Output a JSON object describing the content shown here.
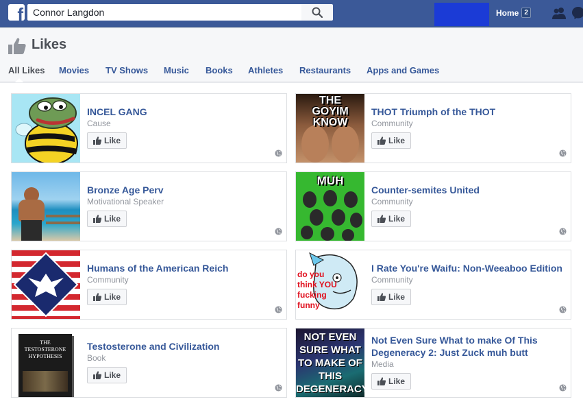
{
  "search": {
    "value": "Connor Langdon"
  },
  "header": {
    "title": "Likes",
    "home_label": "Home",
    "home_badge": "2"
  },
  "tabs": [
    {
      "label": "All Likes",
      "active": true
    },
    {
      "label": "Movies"
    },
    {
      "label": "TV Shows"
    },
    {
      "label": "Music"
    },
    {
      "label": "Books"
    },
    {
      "label": "Athletes"
    },
    {
      "label": "Restaurants"
    },
    {
      "label": "Apps and Games"
    }
  ],
  "like_label": "Like",
  "pages": [
    {
      "name": "INCEL GANG",
      "category": "Cause",
      "thumb_text": ""
    },
    {
      "name": "THOT Triumph of the THOT",
      "category": "Community",
      "thumb_text": "THE GOYIM KNOW"
    },
    {
      "name": "Bronze Age Perv",
      "category": "Motivational Speaker",
      "thumb_text": ""
    },
    {
      "name": "Counter-semites United",
      "category": "Community",
      "thumb_text": "MUH"
    },
    {
      "name": "Humans of the American Reich",
      "category": "Community",
      "thumb_text": ""
    },
    {
      "name": "I Rate You're Waifu: Non-Weeaboo Edition",
      "category": "Community",
      "thumb_text": "do you think YOU fucking funny"
    },
    {
      "name": "Testosterone and Civilization",
      "category": "Book",
      "thumb_text": "THE TESTOSTERONE HYPOTHESIS"
    },
    {
      "name": "Not Even Sure What to make Of This Degeneracy 2: Just Zuck muh butt",
      "category": "Media",
      "thumb_text": "NOT EVEN SURE WHAT TO MAKE OF THIS DEGENERACY"
    }
  ],
  "colors": {
    "brand": "#3b5998",
    "link": "#365899",
    "muted": "#90949c"
  },
  "icons": [
    "facebook-logo-icon",
    "search-icon",
    "friends-icon",
    "messages-icon",
    "thumbs-up-icon",
    "globe-icon"
  ]
}
